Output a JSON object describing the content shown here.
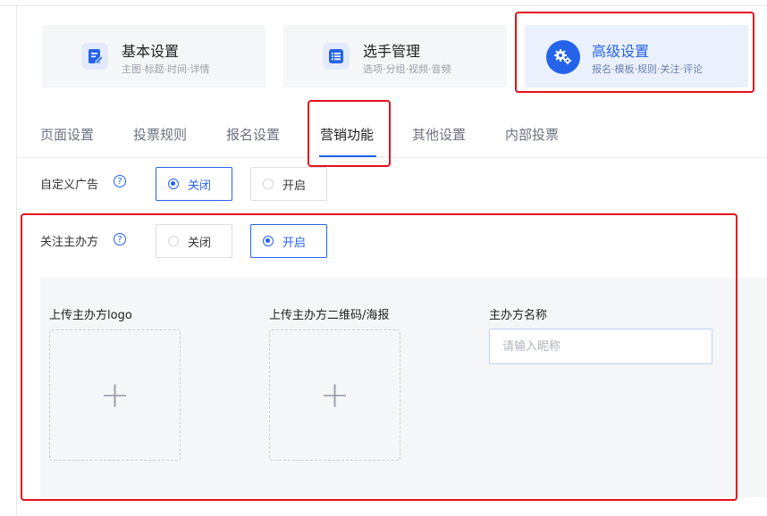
{
  "categories": [
    {
      "title": "基本设置",
      "subtitle": "主图·标题·时间·详情",
      "icon": "edit-document-icon",
      "active": false
    },
    {
      "title": "选手管理",
      "subtitle": "选项·分组·视频·音频",
      "icon": "list-icon",
      "active": false
    },
    {
      "title": "高级设置",
      "subtitle": "报名·模板·规则·关注·评论",
      "icon": "gears-icon",
      "active": true
    }
  ],
  "tabs": [
    "页面设置",
    "投票规则",
    "报名设置",
    "营销功能",
    "其他设置",
    "内部投票"
  ],
  "active_tab": "营销功能",
  "custom_ad": {
    "label": "自定义广告",
    "help": "?",
    "options": [
      "关闭",
      "开启"
    ],
    "selected": "关闭"
  },
  "follow_host": {
    "label": "关注主办方",
    "help": "?",
    "options": [
      "关闭",
      "开启"
    ],
    "selected": "开启"
  },
  "upload": {
    "logo_label": "上传主办方logo",
    "qrcode_label": "上传主办方二维码/海报",
    "plus": "+",
    "name_label": "主办方名称",
    "name_placeholder": "请输入昵称",
    "name_value": ""
  },
  "colors": {
    "accent": "#2563eb",
    "highlight": "#e3101e",
    "panel_bg": "#f5f6f8"
  }
}
